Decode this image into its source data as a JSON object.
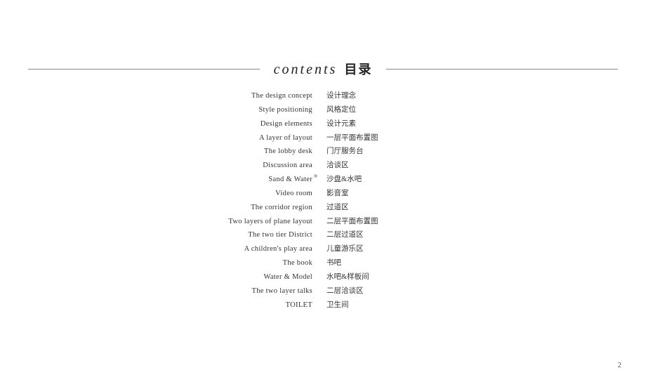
{
  "header": {
    "title_en": "contents",
    "title_cn": "目录"
  },
  "contents": [
    {
      "en": "The design concept",
      "cn": "设计理念"
    },
    {
      "en": "Style positioning",
      "cn": "风格定位"
    },
    {
      "en": "Design elements",
      "cn": "设计元素"
    },
    {
      "en": "A layer of layout",
      "cn": "一层平面布置图"
    },
    {
      "en": "The lobby desk",
      "cn": "门厅服务台"
    },
    {
      "en": "Discussion area",
      "cn": "洽谈区"
    },
    {
      "en": "Sand & Water",
      "cn": "沙盘&水吧"
    },
    {
      "en": "Video room",
      "cn": "影音室"
    },
    {
      "en": "The corridor region",
      "cn": "过道区"
    },
    {
      "en": "Two layers of plane layout",
      "cn": "二层平面布置图"
    },
    {
      "en": "The two tier District",
      "cn": "二层过道区"
    },
    {
      "en": "A children's play area",
      "cn": "儿童游乐区"
    },
    {
      "en": "The book",
      "cn": "书吧"
    },
    {
      "en": "Water & Model",
      "cn": "水吧&样板间"
    },
    {
      "en": "The two layer talks",
      "cn": "二层洽谈区"
    },
    {
      "en": "TOILET",
      "cn": "卫生间"
    }
  ],
  "page_number": "2"
}
